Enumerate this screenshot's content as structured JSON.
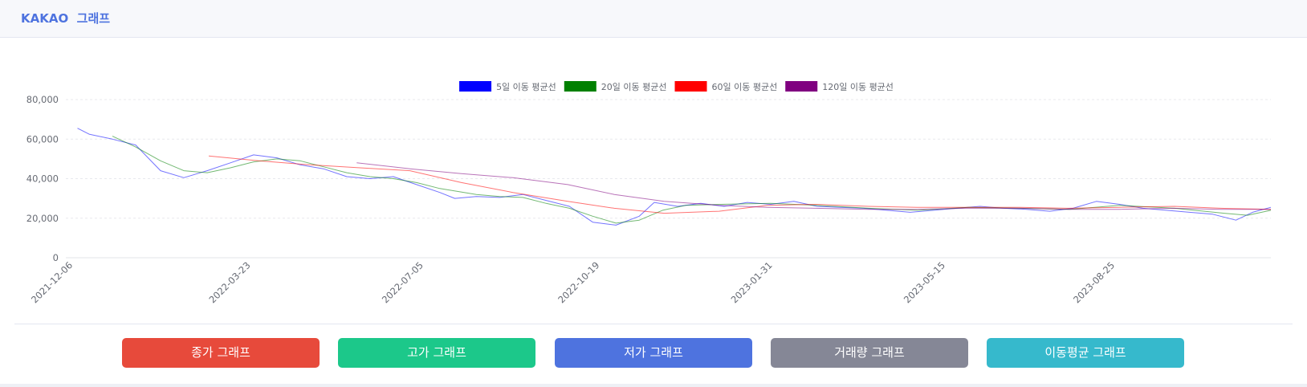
{
  "header": {
    "title": "KAKAO  그래프"
  },
  "buttons": {
    "close": "종가 그래프",
    "high": "고가 그래프",
    "low": "저가 그래프",
    "volume": "거래량 그래프",
    "moving_average": "이동평균 그래프"
  },
  "colors": {
    "accent": "#4e73df",
    "close_button": "#e74a3b",
    "high_button": "#1cc88a",
    "low_button": "#4e73df",
    "volume_button": "#858796",
    "ma_button": "#36b9cc"
  },
  "chart_data": {
    "type": "line",
    "title": "",
    "xlabel": "",
    "ylabel": "",
    "ylim": [
      0,
      80000
    ],
    "yticks": [
      "0",
      "20,000",
      "40,000",
      "60,000",
      "80,000"
    ],
    "xticks": [
      "2021-12-06",
      "2022-03-23",
      "2022-07-05",
      "2022-10-19",
      "2023-01-31",
      "2023-05-15",
      "2023-08-25"
    ],
    "x_range": [
      "2021-12-06",
      "2023-12-01"
    ],
    "grid": "horizontal dashed",
    "legend_position": "top",
    "series": [
      {
        "name": "5일 이동 평균선",
        "color": "#0000ff",
        "points": [
          [
            "2021-12-13",
            65500
          ],
          [
            "2021-12-20",
            62500
          ],
          [
            "2022-01-03",
            60000
          ],
          [
            "2022-01-17",
            57000
          ],
          [
            "2022-02-01",
            44000
          ],
          [
            "2022-02-15",
            40500
          ],
          [
            "2022-03-01",
            44000
          ],
          [
            "2022-03-15",
            48000
          ],
          [
            "2022-03-29",
            52000
          ],
          [
            "2022-04-12",
            50500
          ],
          [
            "2022-04-26",
            47000
          ],
          [
            "2022-05-10",
            45000
          ],
          [
            "2022-05-24",
            41000
          ],
          [
            "2022-06-07",
            40000
          ],
          [
            "2022-06-21",
            41000
          ],
          [
            "2022-07-05",
            37000
          ],
          [
            "2022-07-19",
            33000
          ],
          [
            "2022-07-28",
            30000
          ],
          [
            "2022-08-10",
            31000
          ],
          [
            "2022-08-24",
            30500
          ],
          [
            "2022-09-07",
            32000
          ],
          [
            "2022-09-21",
            29000
          ],
          [
            "2022-10-05",
            26000
          ],
          [
            "2022-10-19",
            18000
          ],
          [
            "2022-11-02",
            16500
          ],
          [
            "2022-11-16",
            21000
          ],
          [
            "2022-11-25",
            28000
          ],
          [
            "2022-12-09",
            26000
          ],
          [
            "2022-12-23",
            27500
          ],
          [
            "2023-01-06",
            26000
          ],
          [
            "2023-01-20",
            28000
          ],
          [
            "2023-02-03",
            27000
          ],
          [
            "2023-02-17",
            28500
          ],
          [
            "2023-03-03",
            26000
          ],
          [
            "2023-03-17",
            25500
          ],
          [
            "2023-03-31",
            25000
          ],
          [
            "2023-04-14",
            24000
          ],
          [
            "2023-04-28",
            23000
          ],
          [
            "2023-05-12",
            24000
          ],
          [
            "2023-05-26",
            25000
          ],
          [
            "2023-06-09",
            26000
          ],
          [
            "2023-06-23",
            25000
          ],
          [
            "2023-07-07",
            24500
          ],
          [
            "2023-07-21",
            23500
          ],
          [
            "2023-08-04",
            25000
          ],
          [
            "2023-08-18",
            28500
          ],
          [
            "2023-09-01",
            27000
          ],
          [
            "2023-09-15",
            25000
          ],
          [
            "2023-09-29",
            24000
          ],
          [
            "2023-10-13",
            23000
          ],
          [
            "2023-10-27",
            22000
          ],
          [
            "2023-11-10",
            19000
          ],
          [
            "2023-11-20",
            23000
          ],
          [
            "2023-12-01",
            25500
          ]
        ]
      },
      {
        "name": "20일 이동 평균선",
        "color": "#008000",
        "points": [
          [
            "2022-01-03",
            61500
          ],
          [
            "2022-01-17",
            56000
          ],
          [
            "2022-02-01",
            49000
          ],
          [
            "2022-02-15",
            44000
          ],
          [
            "2022-03-01",
            43000
          ],
          [
            "2022-03-15",
            45500
          ],
          [
            "2022-03-29",
            48500
          ],
          [
            "2022-04-12",
            50000
          ],
          [
            "2022-04-26",
            49000
          ],
          [
            "2022-05-10",
            46000
          ],
          [
            "2022-05-24",
            43000
          ],
          [
            "2022-06-07",
            41000
          ],
          [
            "2022-06-21",
            40000
          ],
          [
            "2022-07-05",
            38000
          ],
          [
            "2022-07-19",
            35000
          ],
          [
            "2022-08-10",
            32000
          ],
          [
            "2022-08-24",
            31000
          ],
          [
            "2022-09-07",
            30500
          ],
          [
            "2022-09-21",
            27500
          ],
          [
            "2022-10-05",
            25000
          ],
          [
            "2022-10-19",
            21000
          ],
          [
            "2022-11-02",
            17500
          ],
          [
            "2022-11-16",
            19000
          ],
          [
            "2022-11-30",
            24000
          ],
          [
            "2022-12-14",
            26500
          ],
          [
            "2023-01-04",
            27000
          ],
          [
            "2023-02-03",
            27500
          ],
          [
            "2023-03-03",
            26500
          ],
          [
            "2023-04-03",
            25000
          ],
          [
            "2023-05-03",
            24000
          ],
          [
            "2023-06-02",
            25500
          ],
          [
            "2023-07-03",
            25000
          ],
          [
            "2023-08-02",
            24500
          ],
          [
            "2023-09-01",
            26500
          ],
          [
            "2023-10-04",
            25000
          ],
          [
            "2023-11-03",
            22500
          ],
          [
            "2023-11-17",
            21500
          ],
          [
            "2023-12-01",
            24000
          ]
        ]
      },
      {
        "name": "60일 이동 평균선",
        "color": "#ff0000",
        "points": [
          [
            "2022-03-02",
            51500
          ],
          [
            "2022-04-01",
            49000
          ],
          [
            "2022-05-02",
            47000
          ],
          [
            "2022-06-01",
            45500
          ],
          [
            "2022-07-01",
            44000
          ],
          [
            "2022-08-01",
            38000
          ],
          [
            "2022-09-01",
            33000
          ],
          [
            "2022-10-04",
            28500
          ],
          [
            "2022-11-01",
            25000
          ],
          [
            "2022-12-01",
            22500
          ],
          [
            "2023-01-03",
            23500
          ],
          [
            "2023-02-01",
            26500
          ],
          [
            "2023-03-02",
            27000
          ],
          [
            "2023-04-03",
            26000
          ],
          [
            "2023-05-02",
            25500
          ],
          [
            "2023-06-01",
            25500
          ],
          [
            "2023-07-03",
            25500
          ],
          [
            "2023-08-01",
            25000
          ],
          [
            "2023-09-01",
            25500
          ],
          [
            "2023-10-04",
            26000
          ],
          [
            "2023-11-01",
            25000
          ],
          [
            "2023-12-01",
            24500
          ]
        ]
      },
      {
        "name": "120일 이동 평균선",
        "color": "#800080",
        "points": [
          [
            "2022-05-30",
            48000
          ],
          [
            "2022-07-01",
            45000
          ],
          [
            "2022-08-01",
            42500
          ],
          [
            "2022-09-01",
            40500
          ],
          [
            "2022-10-04",
            37000
          ],
          [
            "2022-11-01",
            32000
          ],
          [
            "2022-12-01",
            28500
          ],
          [
            "2023-01-03",
            26500
          ],
          [
            "2023-02-01",
            25500
          ],
          [
            "2023-03-02",
            25000
          ],
          [
            "2023-04-03",
            24500
          ],
          [
            "2023-05-02",
            24500
          ],
          [
            "2023-06-01",
            25000
          ],
          [
            "2023-07-03",
            25000
          ],
          [
            "2023-08-01",
            24500
          ],
          [
            "2023-09-01",
            24500
          ],
          [
            "2023-10-04",
            25000
          ],
          [
            "2023-11-01",
            24500
          ],
          [
            "2023-12-01",
            24500
          ]
        ]
      }
    ]
  }
}
